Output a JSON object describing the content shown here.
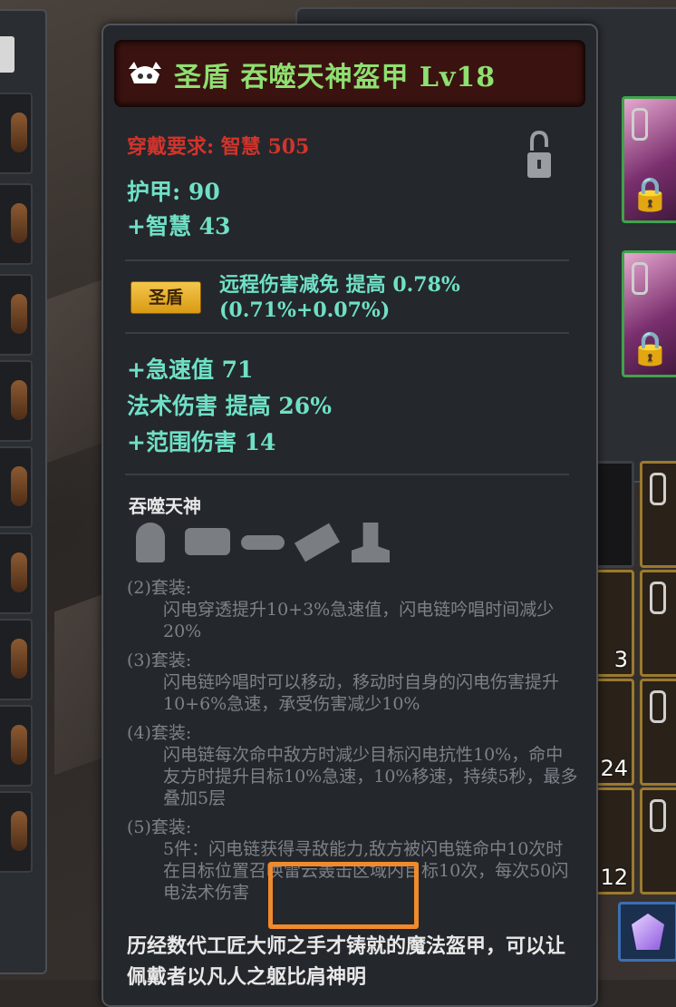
{
  "item": {
    "title": "圣盾 吞噬天神盔甲 Lv18",
    "requirement": "穿戴要求: 智慧 505",
    "armor": "护甲: 90",
    "wisdom": "+智慧 43",
    "badge_label": "圣盾",
    "badge_text": "远程伤害减免 提高 0.78%(0.71%+0.07%)",
    "stat_haste": "+急速值 71",
    "stat_spell": "法术伤害 提高 26%",
    "stat_area": "+范围伤害 14",
    "set_name": "吞噬天神",
    "set_bonus_2_head": "(2)套装:",
    "set_bonus_2_body": "闪电穿透提升10+3%急速值，闪电链吟唱时间减少20%",
    "set_bonus_3_head": "(3)套装:",
    "set_bonus_3_body": "闪电链吟唱时可以移动，移动时自身的闪电伤害提升10+6%急速，承受伤害减少10%",
    "set_bonus_4_head": "(4)套装:",
    "set_bonus_4_body": "闪电链每次命中敌方时减少目标闪电抗性10%，命中友方时提升目标10%急速，10%移速，持续5秒，最多叠加5层",
    "set_bonus_5_head": "(5)套装:",
    "set_bonus_5_body": "5件：闪电链获得寻敌能力,敌方被闪电链命中10次时在目标位置召唤雷云轰击区域内目标10次，每次50闪电法术伤害",
    "lore": "历经数代工匠大师之手才铸就的魔法盔甲，可以让佩戴者以凡人之躯比肩神明"
  },
  "inventory": {
    "counts": [
      "3",
      "24",
      "12"
    ]
  },
  "colors": {
    "title": "#8ee070",
    "requirement": "#d1342c",
    "stat": "#6fe0c6",
    "badge": "#e9b12a",
    "highlight": "#f08a2c"
  },
  "icons": {
    "title": "helmet-icon",
    "lock": "lock-icon",
    "set_pieces": [
      "helmet-icon",
      "shoulder-icon",
      "belt-icon",
      "gauntlet-icon",
      "boot-icon"
    ]
  }
}
